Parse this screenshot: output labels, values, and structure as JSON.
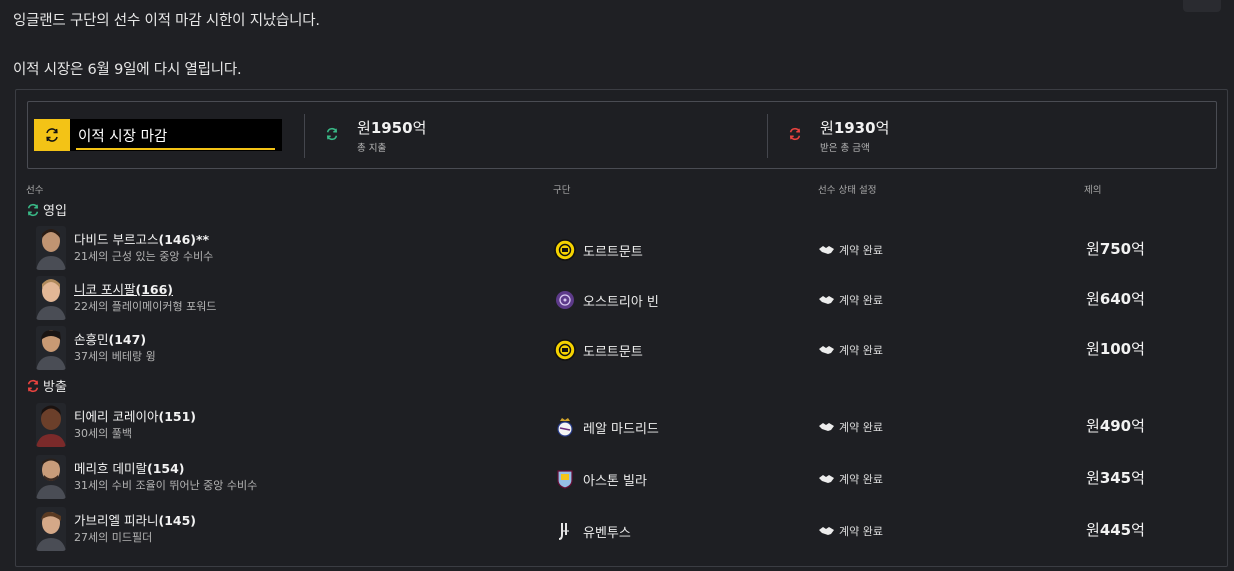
{
  "notice": {
    "line1": "잉글랜드 구단의 선수 이적 마감 시한이 지났습니다.",
    "line2": "이적 시장은 6월 9일에 다시 열립니다."
  },
  "summary": {
    "window_label": "이적 시장 마감",
    "spent": {
      "currency": "원",
      "amount": "1950",
      "unit": "억",
      "label": "총 지출"
    },
    "received": {
      "currency": "원",
      "amount": "1930",
      "unit": "억",
      "label": "받은 총 금액"
    }
  },
  "columns": {
    "player": "선수",
    "club": "구단",
    "status": "선수 상태 설정",
    "offer": "제의"
  },
  "incoming": {
    "label": "영입",
    "players": [
      {
        "name": "다비드 부르고스",
        "ovr": "(146)**",
        "desc": "21세의 근성 있는 중앙 수비수",
        "club": "도르트문트",
        "crest": "dortmund-crest",
        "status": "계약 완료",
        "currency": "원",
        "amount": "750",
        "unit": "억"
      },
      {
        "name": "니코 포시팔",
        "ovr": "(166)",
        "desc": "22세의 플레이메이커형 포워드",
        "club": "오스트리아 빈",
        "crest": "austria-wien-crest",
        "status": "계약 완료",
        "currency": "원",
        "amount": "640",
        "unit": "억"
      },
      {
        "name": "손흥민",
        "ovr": "(147)",
        "desc": "37세의 베테랑 윙",
        "club": "도르트문트",
        "crest": "dortmund-crest",
        "status": "계약 완료",
        "currency": "원",
        "amount": "100",
        "unit": "억"
      }
    ]
  },
  "outgoing": {
    "label": "방출",
    "players": [
      {
        "name": "티에리 코레이아",
        "ovr": "(151)",
        "desc": "30세의 풀백",
        "club": "레알 마드리드",
        "crest": "real-madrid-crest",
        "status": "계약 완료",
        "currency": "원",
        "amount": "490",
        "unit": "억"
      },
      {
        "name": "메리흐 데미랄",
        "ovr": "(154)",
        "desc": "31세의 수비 조율이 뛰어난 중앙 수비수",
        "club": "아스톤 빌라",
        "crest": "aston-villa-crest",
        "status": "계약 완료",
        "currency": "원",
        "amount": "345",
        "unit": "억"
      },
      {
        "name": "가브리엘 피라니",
        "ovr": "(145)",
        "desc": "27세의 미드필더",
        "club": "유벤투스",
        "crest": "juventus-crest",
        "status": "계약 완료",
        "currency": "원",
        "amount": "445",
        "unit": "억"
      }
    ]
  },
  "colors": {
    "accent_yellow": "#f3c316",
    "in_green": "#39b886",
    "out_red": "#e8433f"
  }
}
